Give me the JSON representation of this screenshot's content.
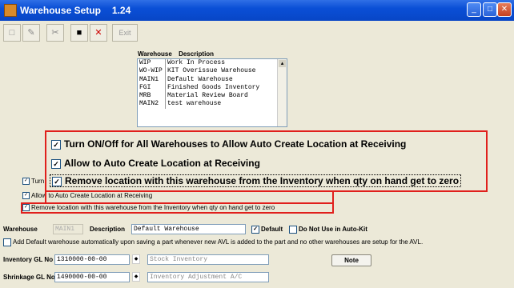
{
  "window": {
    "title": "Warehouse Setup",
    "version": "1.24"
  },
  "toolbar": {
    "exit_label": "Exit"
  },
  "warehouse_list": {
    "header_code": "Warehouse",
    "header_desc": "Description",
    "rows": [
      {
        "code": "WIP",
        "desc": "Work In Process"
      },
      {
        "code": "WO-WIP",
        "desc": "KIT Overissue Warehouse"
      },
      {
        "code": "MAIN1",
        "desc": "Default Warehouse"
      },
      {
        "code": "FGI",
        "desc": "Finished Goods Inventory"
      },
      {
        "code": "MRB",
        "desc": "Material Review Board"
      },
      {
        "code": "MAIN2",
        "desc": "test warehouse"
      }
    ]
  },
  "zoom_callout": {
    "opt1": "Turn ON/Off for All Warehouses to Allow Auto Create Location at Receiving",
    "opt2": "Allow to Auto Create Location at Receiving",
    "opt3": "Remove location with this warehouse from the Inventory when qty on hand get to zero"
  },
  "options": {
    "opt1_partial": "Turn",
    "opt2": "Allow to Auto Create Location at Receiving",
    "opt3": "Remove location with this warehouse from the Inventory when qty on hand get to zero"
  },
  "form": {
    "warehouse_label": "Warehouse",
    "warehouse_value": "MAIN1",
    "description_label": "Description",
    "description_value": "Default Warehouse",
    "default_label": "Default",
    "not_use_label": "Do Not Use in Auto-Kit",
    "add_default_label": "Add Default warehouse automatically upon saving a part whenever new AVL is added to the part and no other warehouses are setup for the AVL.",
    "inv_gl_label": "Inventory GL No",
    "inv_gl_value": "1310000-00-00",
    "inv_gl_desc": "Stock Inventory",
    "shrink_gl_label": "Shrinkage GL No",
    "shrink_gl_value": "1490000-00-00",
    "shrink_gl_desc": "Inventory Adjustment A/C",
    "note_label": "Note"
  }
}
